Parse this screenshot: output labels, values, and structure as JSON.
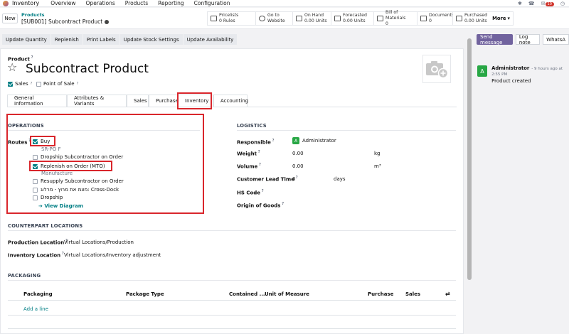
{
  "app": {
    "name": "Inventory"
  },
  "nav": {
    "items": [
      "Overview",
      "Operations",
      "Products",
      "Reporting",
      "Configuration"
    ]
  },
  "topbar": {
    "icons": [
      "bug-icon",
      "phone-icon",
      "chat-icon",
      "clock-icon",
      "user-avatar"
    ],
    "chat_count": "10"
  },
  "control": {
    "new_label": "New",
    "breadcrumb_parent": "Products",
    "breadcrumb_current": "[SUB001] Subcontract Product"
  },
  "smart_buttons": [
    {
      "label": "Pricelists",
      "value": "0 Rules"
    },
    {
      "label": "Go to",
      "value": "Website"
    },
    {
      "label": "On Hand",
      "value": "0.00 Units"
    },
    {
      "label": "Forecasted",
      "value": "0.00 Units"
    },
    {
      "label": "Bill of Materials",
      "value": "0"
    },
    {
      "label": "Documents",
      "value": "0"
    },
    {
      "label": "Purchased",
      "value": "0.00 Units"
    }
  ],
  "more_label": "More",
  "actions": [
    "Update Quantity",
    "Replenish",
    "Print Labels",
    "Update Stock Settings",
    "Update Availability"
  ],
  "chatter": {
    "send_label": "Send message",
    "log_label": "Log note",
    "wa_label": "WhatsA",
    "author": "Administrator",
    "time": "- 9 hours ago at 2:55 PM",
    "text": "Product created",
    "avatar_letter": "A"
  },
  "product": {
    "label": "Product",
    "name": "Subcontract Product",
    "sales_label": "Sales",
    "pos_label": "Point of Sale"
  },
  "tabs": [
    "General Information",
    "Attributes & Variants",
    "Sales",
    "Purchase",
    "Inventory",
    "Accounting"
  ],
  "operations": {
    "title": "OPERATIONS",
    "routes_label": "Routes",
    "routes": [
      {
        "label": "Buy",
        "checked": true,
        "sub": "SR-PO F"
      },
      {
        "label": "Dropship Subcontractor on Order",
        "checked": false,
        "sub": ""
      },
      {
        "label": "Replenish on Order (MTO)",
        "checked": true,
        "sub": "Manufacture"
      },
      {
        "label": "Resupply Subcontractor on Order",
        "checked": false,
        "sub": ""
      },
      {
        "label": "מצמ את מרוץ - מרלוג: Cross-Dock",
        "checked": false,
        "sub": ""
      },
      {
        "label": "Dropship",
        "checked": false,
        "sub": ""
      }
    ],
    "view_diagram": "View Diagram"
  },
  "logistics": {
    "title": "LOGISTICS",
    "responsible_label": "Responsible",
    "responsible_value": "Administrator",
    "weight_label": "Weight",
    "weight_value": "0.00",
    "weight_unit": "kg",
    "volume_label": "Volume",
    "volume_value": "0.00",
    "volume_unit": "m³",
    "lead_label": "Customer Lead Time",
    "lead_value": "0",
    "lead_unit": "days",
    "hs_label": "HS Code",
    "origin_label": "Origin of Goods"
  },
  "counterpart": {
    "title": "COUNTERPART LOCATIONS",
    "production_label": "Production Location",
    "production_value": "Virtual Locations/Production",
    "inventory_label": "Inventory Location",
    "inventory_value": "Virtual Locations/Inventory adjustment"
  },
  "packaging": {
    "title": "PACKAGING",
    "columns": [
      "Packaging",
      "Package Type",
      "Contained ...",
      "Unit of Measure",
      "Purchase",
      "Sales"
    ],
    "add_line": "Add a line"
  }
}
